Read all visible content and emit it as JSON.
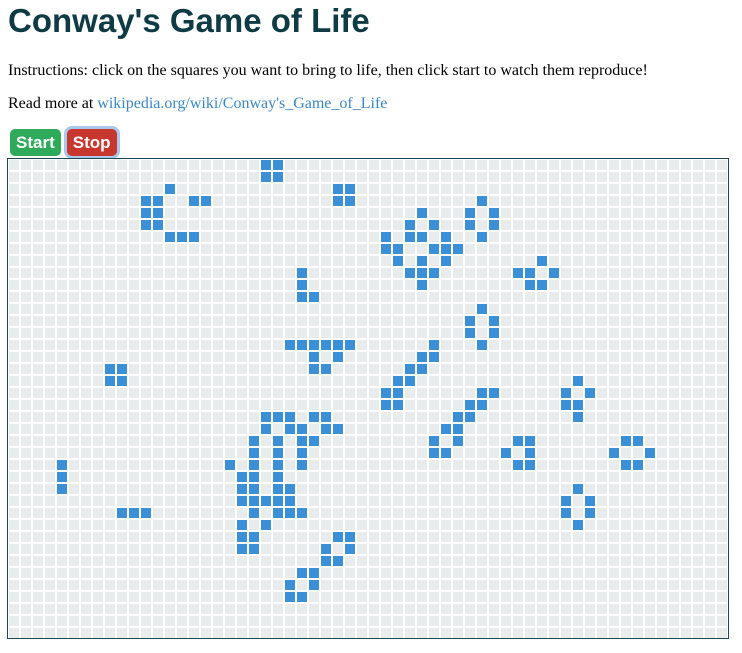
{
  "page": {
    "title": "Conway's Game of Life",
    "instructions": "Instructions: click on the squares you want to bring to life, then click start to watch them reproduce!",
    "read_more_prefix": "Read more at ",
    "read_more_link": "wikipedia.org/wiki/Conway's_Game_of_Life"
  },
  "controls": {
    "start_label": "Start",
    "stop_label": "Stop"
  },
  "board": {
    "columns": 60,
    "rows": 40,
    "colors": {
      "dead": "#e9eced",
      "alive": "#3a8fd6"
    },
    "live_cells": [
      [
        21,
        0
      ],
      [
        22,
        0
      ],
      [
        21,
        1
      ],
      [
        22,
        1
      ],
      [
        13,
        2
      ],
      [
        27,
        2
      ],
      [
        28,
        2
      ],
      [
        11,
        3
      ],
      [
        12,
        3
      ],
      [
        15,
        3
      ],
      [
        16,
        3
      ],
      [
        27,
        3
      ],
      [
        28,
        3
      ],
      [
        39,
        3
      ],
      [
        11,
        4
      ],
      [
        12,
        4
      ],
      [
        34,
        4
      ],
      [
        38,
        4
      ],
      [
        40,
        4
      ],
      [
        11,
        5
      ],
      [
        12,
        5
      ],
      [
        33,
        5
      ],
      [
        35,
        5
      ],
      [
        38,
        5
      ],
      [
        40,
        5
      ],
      [
        13,
        6
      ],
      [
        14,
        6
      ],
      [
        15,
        6
      ],
      [
        31,
        6
      ],
      [
        33,
        6
      ],
      [
        34,
        6
      ],
      [
        36,
        6
      ],
      [
        39,
        6
      ],
      [
        31,
        7
      ],
      [
        32,
        7
      ],
      [
        35,
        7
      ],
      [
        36,
        7
      ],
      [
        37,
        7
      ],
      [
        32,
        8
      ],
      [
        34,
        8
      ],
      [
        36,
        8
      ],
      [
        44,
        8
      ],
      [
        24,
        9
      ],
      [
        33,
        9
      ],
      [
        34,
        9
      ],
      [
        35,
        9
      ],
      [
        42,
        9
      ],
      [
        43,
        9
      ],
      [
        45,
        9
      ],
      [
        24,
        10
      ],
      [
        34,
        10
      ],
      [
        43,
        10
      ],
      [
        44,
        10
      ],
      [
        24,
        11
      ],
      [
        25,
        11
      ],
      [
        39,
        12
      ],
      [
        38,
        13
      ],
      [
        40,
        13
      ],
      [
        38,
        14
      ],
      [
        40,
        14
      ],
      [
        23,
        15
      ],
      [
        24,
        15
      ],
      [
        25,
        15
      ],
      [
        26,
        15
      ],
      [
        27,
        15
      ],
      [
        28,
        15
      ],
      [
        35,
        15
      ],
      [
        39,
        15
      ],
      [
        25,
        16
      ],
      [
        27,
        16
      ],
      [
        34,
        16
      ],
      [
        35,
        16
      ],
      [
        8,
        17
      ],
      [
        9,
        17
      ],
      [
        25,
        17
      ],
      [
        26,
        17
      ],
      [
        33,
        17
      ],
      [
        34,
        17
      ],
      [
        8,
        18
      ],
      [
        9,
        18
      ],
      [
        32,
        18
      ],
      [
        33,
        18
      ],
      [
        47,
        18
      ],
      [
        31,
        19
      ],
      [
        32,
        19
      ],
      [
        39,
        19
      ],
      [
        40,
        19
      ],
      [
        46,
        19
      ],
      [
        48,
        19
      ],
      [
        31,
        20
      ],
      [
        32,
        20
      ],
      [
        38,
        20
      ],
      [
        39,
        20
      ],
      [
        46,
        20
      ],
      [
        47,
        20
      ],
      [
        21,
        21
      ],
      [
        22,
        21
      ],
      [
        23,
        21
      ],
      [
        25,
        21
      ],
      [
        26,
        21
      ],
      [
        37,
        21
      ],
      [
        38,
        21
      ],
      [
        47,
        21
      ],
      [
        21,
        22
      ],
      [
        23,
        22
      ],
      [
        24,
        22
      ],
      [
        26,
        22
      ],
      [
        27,
        22
      ],
      [
        36,
        22
      ],
      [
        37,
        22
      ],
      [
        20,
        23
      ],
      [
        22,
        23
      ],
      [
        24,
        23
      ],
      [
        25,
        23
      ],
      [
        35,
        23
      ],
      [
        37,
        23
      ],
      [
        42,
        23
      ],
      [
        43,
        23
      ],
      [
        51,
        23
      ],
      [
        52,
        23
      ],
      [
        20,
        24
      ],
      [
        22,
        24
      ],
      [
        24,
        24
      ],
      [
        35,
        24
      ],
      [
        36,
        24
      ],
      [
        41,
        24
      ],
      [
        43,
        24
      ],
      [
        50,
        24
      ],
      [
        53,
        24
      ],
      [
        4,
        25
      ],
      [
        18,
        25
      ],
      [
        20,
        25
      ],
      [
        22,
        25
      ],
      [
        24,
        25
      ],
      [
        42,
        25
      ],
      [
        43,
        25
      ],
      [
        51,
        25
      ],
      [
        52,
        25
      ],
      [
        4,
        26
      ],
      [
        19,
        26
      ],
      [
        20,
        26
      ],
      [
        22,
        26
      ],
      [
        4,
        27
      ],
      [
        19,
        27
      ],
      [
        20,
        27
      ],
      [
        22,
        27
      ],
      [
        23,
        27
      ],
      [
        47,
        27
      ],
      [
        19,
        28
      ],
      [
        20,
        28
      ],
      [
        21,
        28
      ],
      [
        22,
        28
      ],
      [
        23,
        28
      ],
      [
        46,
        28
      ],
      [
        48,
        28
      ],
      [
        9,
        29
      ],
      [
        10,
        29
      ],
      [
        11,
        29
      ],
      [
        20,
        29
      ],
      [
        22,
        29
      ],
      [
        23,
        29
      ],
      [
        24,
        29
      ],
      [
        46,
        29
      ],
      [
        48,
        29
      ],
      [
        19,
        30
      ],
      [
        21,
        30
      ],
      [
        47,
        30
      ],
      [
        19,
        31
      ],
      [
        20,
        31
      ],
      [
        27,
        31
      ],
      [
        28,
        31
      ],
      [
        19,
        32
      ],
      [
        20,
        32
      ],
      [
        26,
        32
      ],
      [
        28,
        32
      ],
      [
        26,
        33
      ],
      [
        27,
        33
      ],
      [
        24,
        34
      ],
      [
        25,
        34
      ],
      [
        23,
        35
      ],
      [
        25,
        35
      ],
      [
        23,
        36
      ],
      [
        24,
        36
      ]
    ]
  }
}
